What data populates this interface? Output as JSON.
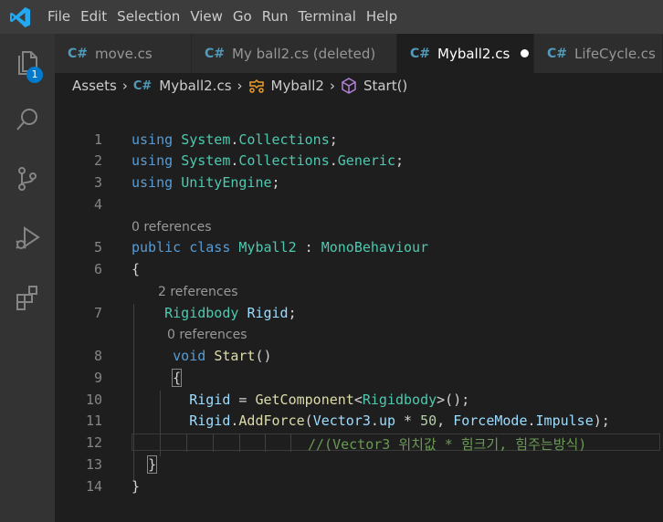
{
  "menu": [
    "File",
    "Edit",
    "Selection",
    "View",
    "Go",
    "Run",
    "Terminal",
    "Help"
  ],
  "activity": {
    "badge": "1"
  },
  "tabs": [
    {
      "icon": "C#",
      "label": "move.cs"
    },
    {
      "icon": "C#",
      "label": "My ball2.cs (deleted)"
    },
    {
      "icon": "C#",
      "label": "Myball2.cs"
    },
    {
      "icon": "C#",
      "label": "LifeCycle.cs"
    }
  ],
  "breadcrumbs": {
    "folder": "Assets",
    "file": "Myball2.cs",
    "cls": "Myball2",
    "method": "Start()"
  },
  "lens": {
    "class_refs": "0 references",
    "field_refs": "2 references",
    "method_refs": "0 references"
  },
  "lines": {
    "n": [
      "1",
      "2",
      "3",
      "4",
      "5",
      "6",
      "7",
      "8",
      "9",
      "10",
      "11",
      "12",
      "13",
      "14"
    ],
    "l1": {
      "kw": "using",
      "a": "System",
      "dot": ".",
      "b": "Collections",
      "semi": ";"
    },
    "l2": {
      "kw": "using",
      "a": "System",
      "dot1": ".",
      "b": "Collections",
      "dot2": ".",
      "c": "Generic",
      "semi": ";"
    },
    "l3": {
      "kw": "using",
      "a": "UnityEngine",
      "semi": ";"
    },
    "l5": {
      "kw1": "public",
      "kw2": "class",
      "name": "Myball2",
      "colon": ":",
      "base": "MonoBehaviour"
    },
    "l6": "{",
    "l7": {
      "type": "Rigidbody",
      "name": "Rigid",
      "semi": ";"
    },
    "l8": {
      "kw": "void",
      "name": "Start",
      "paren": "()"
    },
    "l9": "{",
    "l10": {
      "var": "Rigid",
      "eq": "=",
      "fn": "GetComponent",
      "lt": "<",
      "type": "Rigidbody",
      "tail": ">();"
    },
    "l11": {
      "var": "Rigid",
      "dot": ".",
      "fn": "AddForce",
      "open": "(",
      "t1": "Vector3",
      "d1": ".",
      "up": "up",
      "mul": "*",
      "num": "50",
      "comma": ",",
      "t2": "ForceMode",
      "d2": ".",
      "imp": "Impulse",
      "close": ");"
    },
    "l12": "//(Vector3 위치값 * 힘크기, 힘주는방식)",
    "l13": "}",
    "l14": "}"
  }
}
